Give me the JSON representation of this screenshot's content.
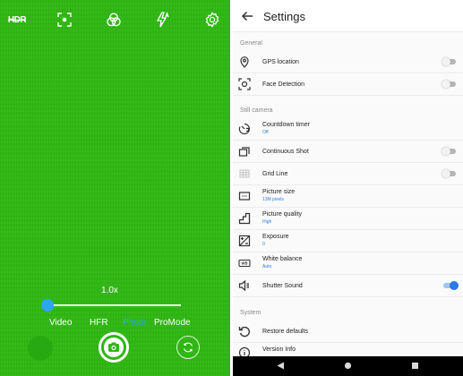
{
  "camera": {
    "hdr_label": "HDR",
    "zoom_label": "1.0x",
    "zoom_level": 0,
    "modes": [
      {
        "label": "Video",
        "active": false
      },
      {
        "label": "HFR",
        "active": false
      },
      {
        "label": "Photo",
        "active": true
      },
      {
        "label": "ProMode",
        "active": false
      }
    ],
    "icons": [
      "hdr-icon",
      "focus-icon",
      "filter-icon",
      "flash-auto-icon",
      "settings-icon",
      "shutter-icon",
      "switch-camera-icon"
    ],
    "colors": {
      "viewfinder": "#2fb713",
      "accent": "#2da6f5"
    }
  },
  "settings": {
    "title": "Settings",
    "sections": {
      "general": "General",
      "still_camera": "Still camera",
      "system": "System"
    },
    "items": [
      {
        "title": "GPS location",
        "subtitle": "",
        "toggle": "off"
      },
      {
        "title": "Face Detection",
        "subtitle": "",
        "toggle": "off"
      },
      {
        "title": "Countdown timer",
        "subtitle": "Off",
        "toggle": ""
      },
      {
        "title": "Continuous Shot",
        "subtitle": "",
        "toggle": "off"
      },
      {
        "title": "Grid Line",
        "subtitle": "",
        "toggle": "off"
      },
      {
        "title": "Picture size",
        "subtitle": "13M pixels",
        "toggle": ""
      },
      {
        "title": "Picture quality",
        "subtitle": "High",
        "toggle": ""
      },
      {
        "title": "Exposure",
        "subtitle": "0",
        "toggle": ""
      },
      {
        "title": "White balance",
        "subtitle": "Auto",
        "toggle": ""
      },
      {
        "title": "Shutter Sound",
        "subtitle": "",
        "toggle": "on"
      },
      {
        "title": "Restore defaults",
        "subtitle": "",
        "toggle": ""
      },
      {
        "title": "Version Info",
        "subtitle": "",
        "toggle": ""
      }
    ],
    "colors": {
      "toggle_on": "#2b7ae8",
      "subtitle": "#2f7fe0"
    }
  }
}
